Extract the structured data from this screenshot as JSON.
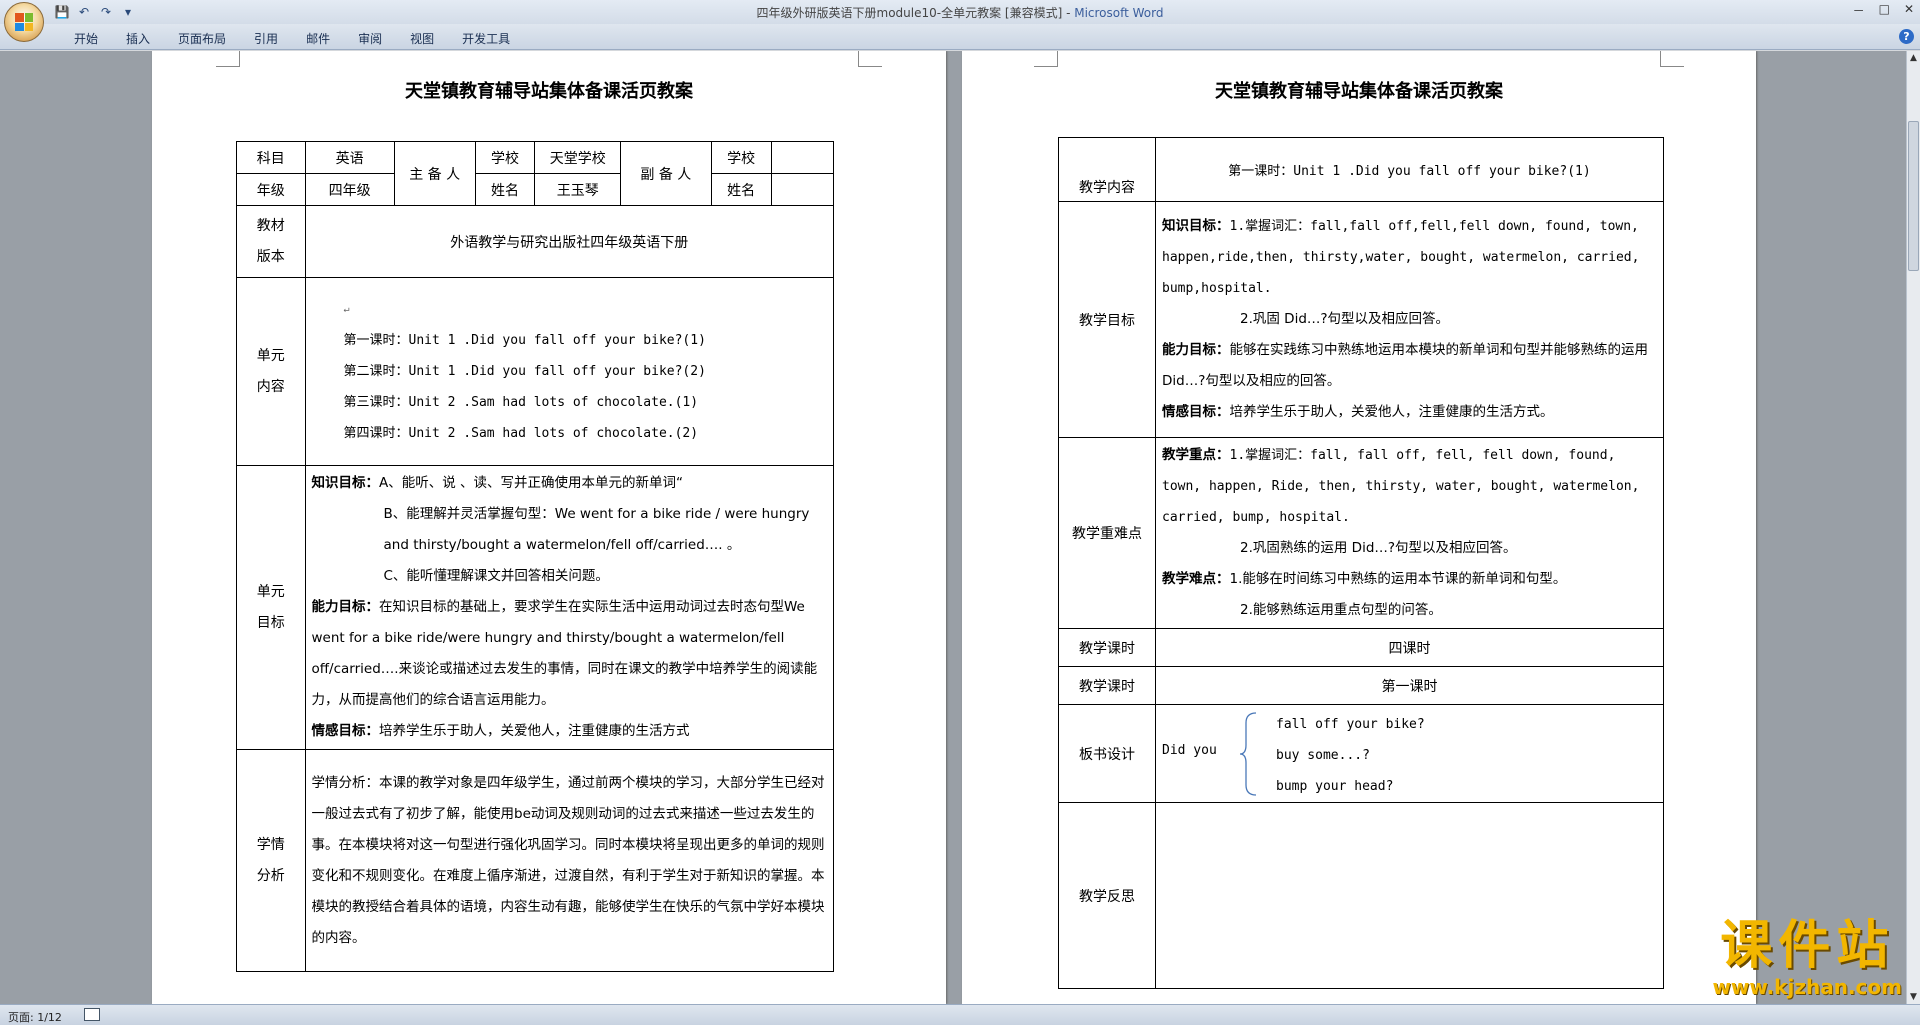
{
  "window": {
    "title": "四年级外研版英语下册module10-全单元教案 [兼容模式] - ",
    "app": "Microsoft Word",
    "controls": {
      "min": "－",
      "max": "□",
      "close": "✕"
    }
  },
  "qat": {
    "save": "💾",
    "undo": "↶",
    "redo": "↷",
    "more": "▾"
  },
  "ribbon": {
    "tabs": [
      "开始",
      "插入",
      "页面布局",
      "引用",
      "邮件",
      "审阅",
      "视图",
      "开发工具"
    ],
    "help": "?"
  },
  "status": {
    "page": "页面: 1/12"
  },
  "left": {
    "title": "天堂镇教育辅导站集体备课活页教案",
    "subject_label": "科目",
    "subject": "英语",
    "main_preparer": "主 备 人",
    "school_label": "学校",
    "school": "天堂学校",
    "vice_preparer": "副 备 人",
    "school_label2": "学校",
    "grade_label": "年级",
    "grade": "四年级",
    "name_label": "姓名",
    "name": "王玉琴",
    "name_label2": "姓名",
    "textbook_label": "教材\n版本",
    "textbook": "外语教学与研究出版社四年级英语下册",
    "unit_content_label": "单元\n内容",
    "unit_content": [
      "第一课时：Unit 1 .Did you fall off your bike?(1)",
      "第二课时：Unit 1 .Did you fall off your bike?(2)",
      "第三课时：Unit 2 .Sam had lots of chocolate.(1)",
      "第四课时：Unit 2 .Sam had lots of chocolate.(2)"
    ],
    "unit_goal_label": "单元\n目标",
    "goal_k_head": "知识目标：",
    "goal_k_a": "A、能听、说 、读、写并正确使用本单元的新单词“",
    "goal_k_b": "B、能理解并灵活掌握句型：We went for a bike ride / were hungry and thirsty/bought a watermelon/fell off/carried…. 。",
    "goal_k_c": "C、能听懂理解课文并回答相关问题。",
    "goal_a_head": "能力目标：",
    "goal_a": "在知识目标的基础上，要求学生在实际生活中运用动词过去时态句型We went for a bike ride/were hungry and thirsty/bought a watermelon/fell off/carried….来谈论或描述过去发生的事情，同时在课文的教学中培养学生的阅读能力，从而提高他们的综合语言运用能力。",
    "goal_e_head": "情感目标：",
    "goal_e": "培养学生乐于助人，关爱他人，注重健康的生活方式",
    "analysis_label": "学情\n分析",
    "analysis": "学情分析：本课的教学对象是四年级学生，通过前两个模块的学习，大部分学生已经对一般过去式有了初步了解，能使用be动词及规则动词的过去式来描述一些过去发生的事。在本模块将对这一句型进行强化巩固学习。同时本模块将呈现出更多的单词的规则变化和不规则变化。在难度上循序渐进，过渡自然，有利于学生对于新知识的掌握。本模块的教授结合着具体的语境，内容生动有趣，能够使学生在快乐的气氛中学好本模块的内容。"
  },
  "right": {
    "title": "天堂镇教育辅导站集体备课活页教案",
    "content_label": "教学内容",
    "content": "第一课时：Unit 1 .Did you fall off your bike?(1)",
    "goal_label": "教学目标",
    "k_head": "知识目标：",
    "k_text": "1.掌握词汇：fall,fall off,fell,fell down, found, town, happen,ride,then, thirsty,water, bought, watermelon, carried, bump,hospital.",
    "k_text2": "2.巩固 Did…?句型以及相应回答。",
    "a_head": "能力目标：",
    "a_text": "能够在实践练习中熟练地运用本模块的新单词和句型并能够熟练的运用 Did…?句型以及相应的回答。",
    "e_head": "情感目标：",
    "e_text": "培养学生乐于助人，关爱他人，注重健康的生活方式。",
    "key_label": "教学重难点",
    "key_head": "教学重点：",
    "key_text": "1.掌握词汇：fall, fall off, fell, fell down, found, town, happen, Ride, then, thirsty, water, bought, watermelon, carried, bump, hospital.",
    "key_text2": "2.巩固熟练的运用 Did…?句型以及相应回答。",
    "diff_head": "教学难点：",
    "diff_text": "1.能够在时间练习中熟练的运用本节课的新单词和句型。",
    "diff_text2": "2.能够熟练运用重点句型的问答。",
    "period_label": "教学课时",
    "period": "四课时",
    "period_label2": "教学课时",
    "period2": "第一课时",
    "board_label": "板书设计",
    "board_lead": "Did you",
    "board_items": [
      "fall off your bike?",
      "buy some...?",
      "bump your head?"
    ],
    "reflect_label": "教学反思"
  },
  "watermark": {
    "main": "课件站",
    "url": "www.kjzhan.com"
  }
}
